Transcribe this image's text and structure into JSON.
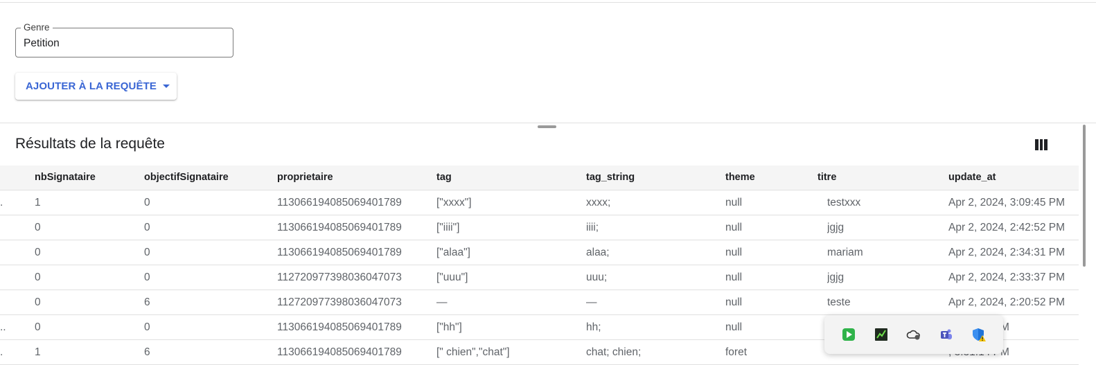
{
  "filter": {
    "genre_label": "Genre",
    "genre_value": "Petition",
    "add_button_label": "AJOUTER À LA REQUÊTE"
  },
  "results": {
    "title": "Résultats de la requête",
    "columns": [
      "nbSignataire",
      "objectifSignataire",
      "proprietaire",
      "tag",
      "tag_string",
      "theme",
      "titre",
      "update_at"
    ],
    "rows": [
      {
        "cut": ".",
        "nbSignataire": "1",
        "objectifSignataire": "0",
        "proprietaire": "113066194085069401789",
        "tag": "[\"xxxx\"]",
        "tag_string": "xxxx;",
        "theme": "null",
        "titre": "testxxx",
        "update_at": "Apr 2, 2024, 3:09:45 PM"
      },
      {
        "cut": "",
        "nbSignataire": "0",
        "objectifSignataire": "0",
        "proprietaire": "113066194085069401789",
        "tag": "[\"iiii\"]",
        "tag_string": "iiii;",
        "theme": "null",
        "titre": "jgjg",
        "update_at": "Apr 2, 2024, 2:42:52 PM"
      },
      {
        "cut": "",
        "nbSignataire": "0",
        "objectifSignataire": "0",
        "proprietaire": "113066194085069401789",
        "tag": "[\"alaa\"]",
        "tag_string": "alaa;",
        "theme": "null",
        "titre": "mariam",
        "update_at": "Apr 2, 2024, 2:34:31 PM"
      },
      {
        "cut": "",
        "nbSignataire": "0",
        "objectifSignataire": "0",
        "proprietaire": "112720977398036047073",
        "tag": "[\"uuu\"]",
        "tag_string": "uuu;",
        "theme": "null",
        "titre": "jgjg",
        "update_at": "Apr 2, 2024, 2:33:37 PM"
      },
      {
        "cut": "",
        "nbSignataire": "0",
        "objectifSignataire": "6",
        "proprietaire": "112720977398036047073",
        "tag": "—",
        "tag_string": "—",
        "theme": "null",
        "titre": "teste",
        "update_at": "Apr 2, 2024, 2:20:52 PM"
      },
      {
        "cut": "...",
        "nbSignataire": "0",
        "objectifSignataire": "0",
        "proprietaire": "113066194085069401789",
        "tag": "[\"hh\"]",
        "tag_string": "hh;",
        "theme": "null",
        "titre": "",
        "update_at": ", 2:08:56 PM"
      },
      {
        "cut": ".",
        "nbSignataire": "1",
        "objectifSignataire": "6",
        "proprietaire": "113066194085069401789",
        "tag": "[\" chien\",\"chat\"]",
        "tag_string": "chat; chien;",
        "theme": "foret",
        "titre": "",
        "update_at": ", 3:31:14 PM"
      }
    ]
  },
  "tray": {
    "icons": [
      "media-player-icon",
      "terminal-icon",
      "onedrive-cloud-icon",
      "teams-icon",
      "security-warning-icon"
    ]
  },
  "colors": {
    "accent": "#3a66d4",
    "header_bg": "#f5f5f5",
    "cell_text": "#5f6368"
  }
}
